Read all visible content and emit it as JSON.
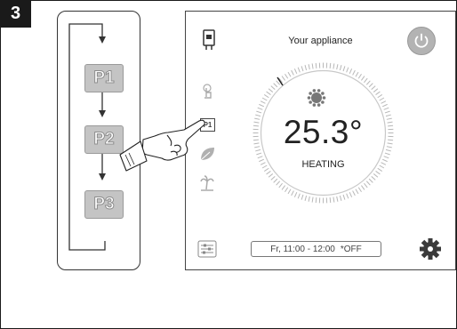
{
  "step_number": "3",
  "programs": [
    "P1",
    "P2",
    "P3"
  ],
  "screen": {
    "title": "Your appliance",
    "temperature": "25.3°",
    "mode": "HEATING",
    "schedule_time": "Fr, 11:00 - 12:00",
    "schedule_state": "*OFF",
    "mini_program_label": "P1"
  },
  "colors": {
    "button_fill": "#c4c4c4",
    "line": "#333333",
    "icon_gray": "#9a9a9a"
  },
  "icons": [
    "boiler-icon",
    "touch-icon",
    "program-icon",
    "eco-leaf-icon",
    "holiday-palm-icon",
    "filter-settings-icon",
    "gear-icon",
    "power-icon",
    "sun-gear-icon",
    "pointing-hand-icon"
  ]
}
